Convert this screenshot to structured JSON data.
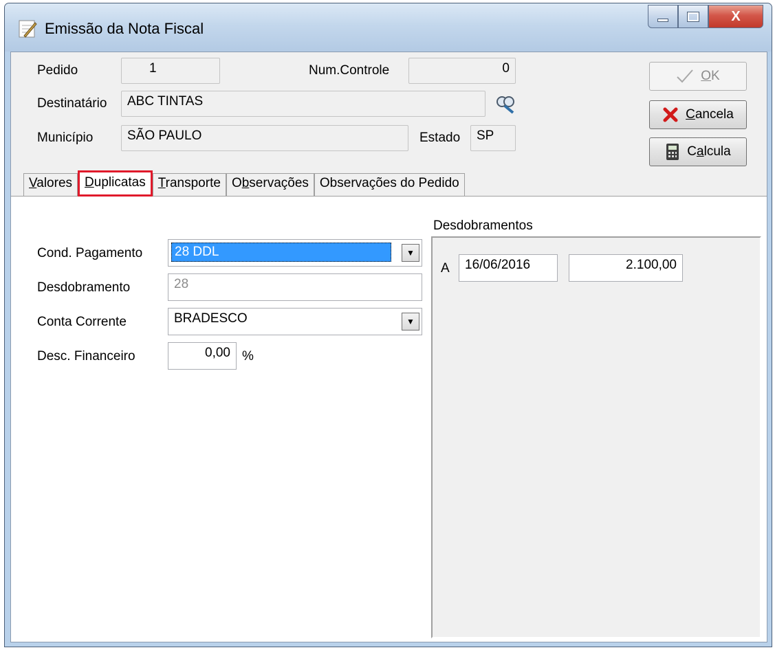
{
  "window": {
    "title": "Emissão da Nota Fiscal",
    "close_glyph": "X"
  },
  "header": {
    "pedido_label": "Pedido",
    "pedido_value": "1",
    "num_controle_label": "Num.Controle",
    "num_controle_value": "0",
    "destinatario_label": "Destinatário",
    "destinatario_value": "ABC TINTAS",
    "municipio_label": "Município",
    "municipio_value": "SÃO PAULO",
    "estado_label": "Estado",
    "estado_value": "SP"
  },
  "buttons": {
    "ok": {
      "pre": "",
      "accel": "O",
      "post": "K"
    },
    "cancela": {
      "pre": "",
      "accel": "C",
      "post": "ancela"
    },
    "calcula": {
      "pre": "C",
      "accel": "a",
      "post": "lcula"
    }
  },
  "tabs": [
    {
      "accel": "V",
      "rest": "alores"
    },
    {
      "accel": "D",
      "rest": "uplicatas"
    },
    {
      "accel": "T",
      "rest": "ransporte"
    },
    {
      "pre": "O",
      "accel": "b",
      "rest": "servações"
    },
    {
      "pre": "Observações do Pedido",
      "accel": "",
      "rest": ""
    }
  ],
  "duplicatas": {
    "cond_pagamento_label": "Cond. Pagamento",
    "cond_pagamento_value": "28 DDL",
    "desdobramento_label": "Desdobramento",
    "desdobramento_value": "28",
    "conta_corrente_label": "Conta Corrente",
    "conta_corrente_value": "BRADESCO",
    "desc_financeiro_label": "Desc. Financeiro",
    "desc_financeiro_value": "0,00",
    "percent_sign": "%",
    "desdobramentos_title": "Desdobramentos",
    "rows": [
      {
        "letter": "A",
        "date": "16/06/2016",
        "amount": "2.100,00"
      }
    ]
  },
  "colors": {
    "title_bar": "#c3d7ec",
    "active_tab_highlight": "#e01a2b",
    "selection": "#3399ff",
    "cancel_icon": "#d11a1a"
  },
  "icons": [
    "form-icon",
    "search-binoculars-icon",
    "checkmark-icon",
    "cancel-x-icon",
    "calculator-icon",
    "dropdown-arrow-icon"
  ]
}
